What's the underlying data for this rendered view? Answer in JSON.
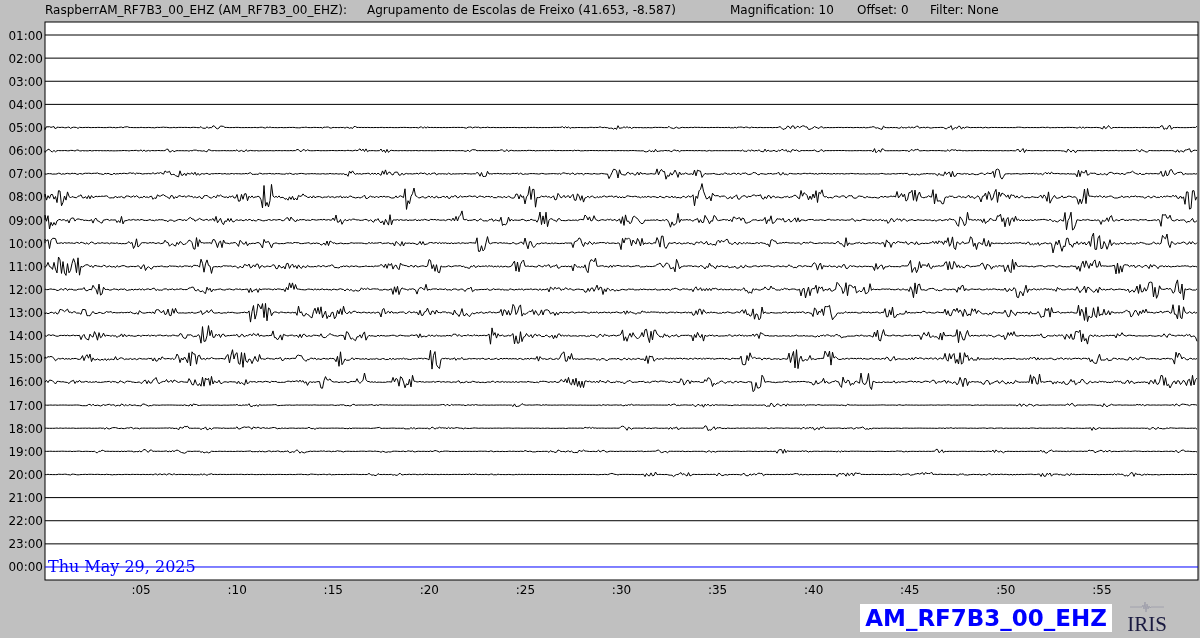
{
  "header": {
    "station": "RaspberrAM_RF7B3_00_EHZ (AM_RF7B3_00_EHZ):",
    "location": "Agrupamento de Escolas de Freixo (41.653, -8.587)",
    "magnification": "Magnification: 10",
    "offset": "Offset: 0",
    "filter": "Filter: None"
  },
  "helicorder": {
    "rows": [
      {
        "time": "01:00",
        "kind": "quiet"
      },
      {
        "time": "02:00",
        "kind": "quiet"
      },
      {
        "time": "03:00",
        "kind": "quiet"
      },
      {
        "time": "04:00",
        "kind": "quiet"
      },
      {
        "time": "05:00",
        "kind": "faint"
      },
      {
        "time": "06:00",
        "kind": "faint"
      },
      {
        "time": "07:00",
        "kind": "light"
      },
      {
        "time": "08:00",
        "kind": "heavy"
      },
      {
        "time": "09:00",
        "kind": "medium"
      },
      {
        "time": "10:00",
        "kind": "medium"
      },
      {
        "time": "11:00",
        "kind": "medium"
      },
      {
        "time": "12:00",
        "kind": "medium"
      },
      {
        "time": "13:00",
        "kind": "medium"
      },
      {
        "time": "14:00",
        "kind": "medium"
      },
      {
        "time": "15:00",
        "kind": "medium"
      },
      {
        "time": "16:00",
        "kind": "medium"
      },
      {
        "time": "17:00",
        "kind": "faint"
      },
      {
        "time": "18:00",
        "kind": "faint"
      },
      {
        "time": "19:00",
        "kind": "faint"
      },
      {
        "time": "20:00",
        "kind": "faint"
      },
      {
        "time": "21:00",
        "kind": "quiet"
      },
      {
        "time": "22:00",
        "kind": "quiet"
      },
      {
        "time": "23:00",
        "kind": "quiet"
      },
      {
        "time": "00:00",
        "kind": "current"
      }
    ],
    "date": "Thu May 29, 2025",
    "minute_ticks": [
      ":05",
      ":10",
      ":15",
      ":20",
      ":25",
      ":30",
      ":35",
      ":40",
      ":45",
      ":50",
      ":55"
    ]
  },
  "footer": {
    "channel": "AM_RF7B3_00_EHZ",
    "logo": "IRIS"
  }
}
